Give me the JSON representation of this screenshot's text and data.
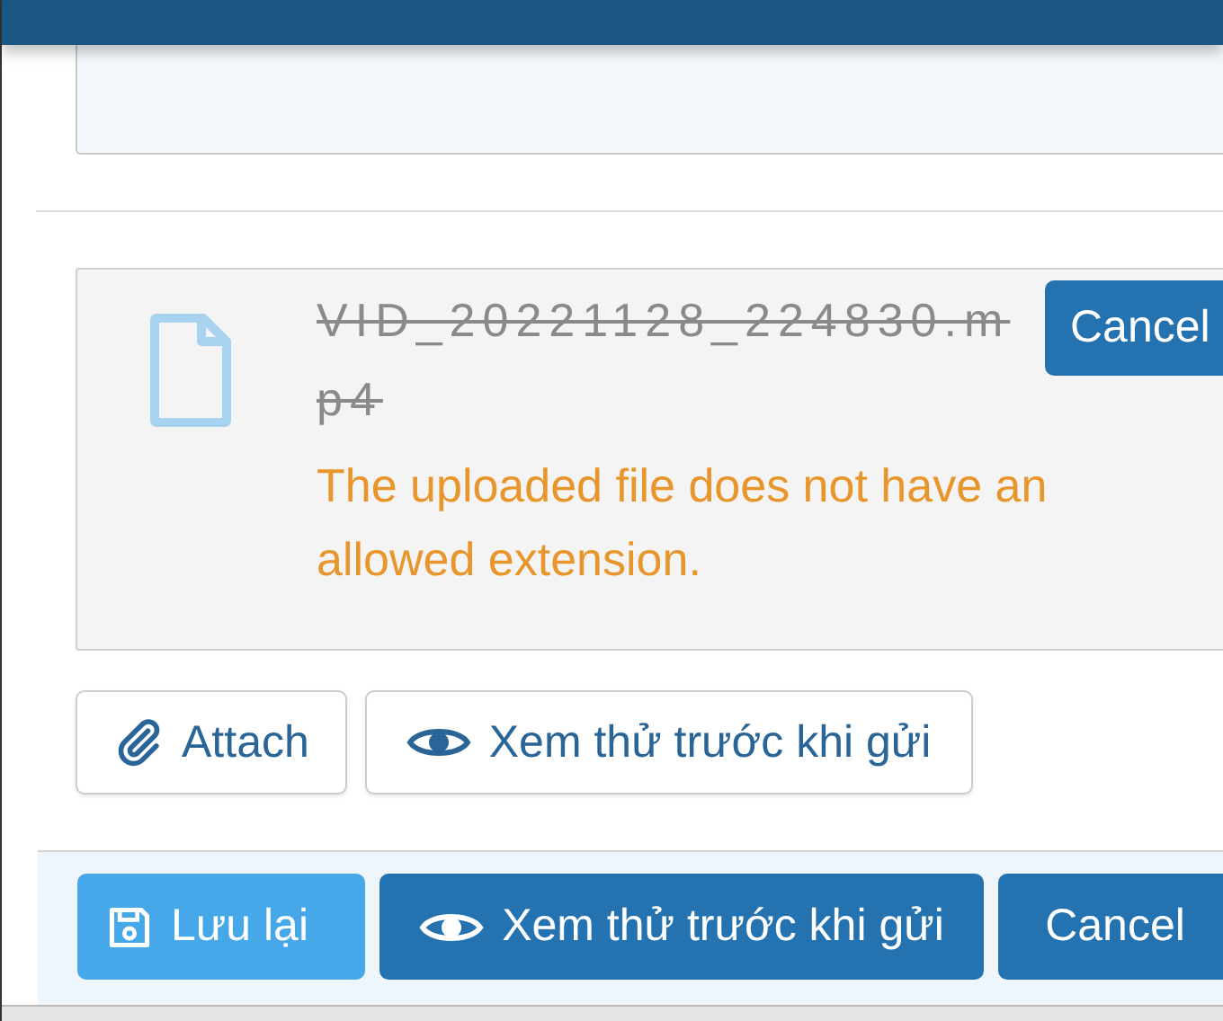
{
  "upload": {
    "file_name": "VID_20221128_224830.mp4",
    "rejected": true,
    "cancel_label": "Cancel",
    "error": "The uploaded file does not have an allowed extension."
  },
  "actions": [
    {
      "kind": "attach",
      "label": "Attach"
    },
    {
      "kind": "preview",
      "label": "Xem thử trước khi gửi"
    }
  ],
  "footer_buttons": [
    {
      "kind": "save",
      "label": "Lưu lại"
    },
    {
      "kind": "preview",
      "label": "Xem thử trước khi gửi"
    },
    {
      "kind": "cancel",
      "label": "Cancel"
    }
  ]
}
